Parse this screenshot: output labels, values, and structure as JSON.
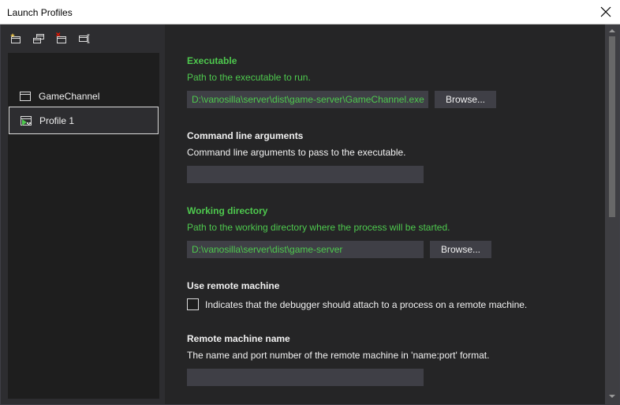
{
  "window": {
    "title": "Launch Profiles",
    "close_icon": "close-icon"
  },
  "toolbar": {
    "icons": [
      "new-profile-icon",
      "duplicate-profile-icon",
      "delete-profile-icon",
      "rename-profile-icon"
    ]
  },
  "profiles": [
    {
      "label": "GameChannel",
      "icon": "window-icon",
      "selected": false
    },
    {
      "label": "Profile 1",
      "icon": "executable-icon",
      "selected": true
    }
  ],
  "form": {
    "executable": {
      "heading": "Executable",
      "description": "Path to the executable to run.",
      "value": "D:\\vanosilla\\server\\dist\\game-server\\GameChannel.exe",
      "browse_label": "Browse..."
    },
    "arguments": {
      "heading": "Command line arguments",
      "description": "Command line arguments to pass to the executable.",
      "value": ""
    },
    "working_directory": {
      "heading": "Working directory",
      "description": "Path to the working directory where the process will be started.",
      "value": "D:\\vanosilla\\server\\dist\\game-server",
      "browse_label": "Browse..."
    },
    "remote": {
      "heading": "Use remote machine",
      "checkbox_label": "Indicates that the debugger should attach to a process on a remote machine.",
      "checked": false
    },
    "remote_name": {
      "heading": "Remote machine name",
      "description": "The name and port number of the remote machine in 'name:port' format.",
      "value": ""
    }
  },
  "colors": {
    "accent_green": "#4ec94e",
    "background": "#252526",
    "panel": "#2d2d30",
    "field": "#3f3f46"
  }
}
